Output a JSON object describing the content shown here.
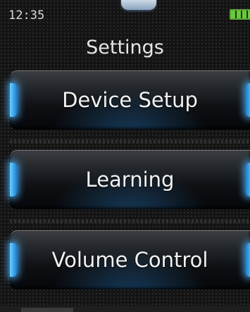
{
  "status_bar": {
    "time": "12:35",
    "battery_icon": "battery-icon"
  },
  "header": {
    "title": "Settings"
  },
  "menu": {
    "items": [
      {
        "label": "Device Setup"
      },
      {
        "label": "Learning"
      },
      {
        "label": "Volume Control"
      }
    ]
  },
  "colors": {
    "accent_glow": "#4fb8ff",
    "battery": "#6cc83c",
    "text": "#f2f2f2"
  }
}
